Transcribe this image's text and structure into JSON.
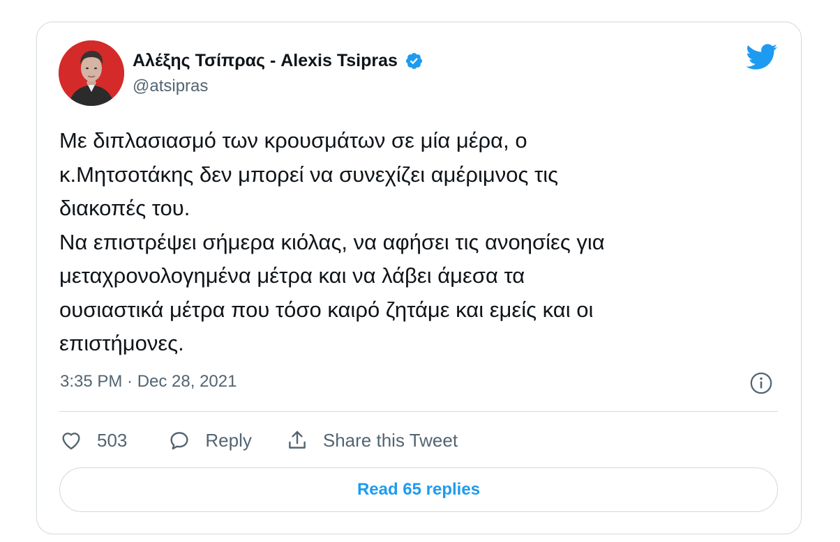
{
  "author": {
    "display_name": "Αλέξης Τσίπρας - Alexis Tsipras",
    "handle": "@atsipras"
  },
  "tweet": {
    "lines": [
      "Με διπλασιασμό των κρουσμάτων σε μία μέρα, ο",
      "κ.Μητσοτάκης δεν μπορεί να συνεχίζει αμέριμνος τις",
      "διακοπές του.",
      "Να επιστρέψει σήμερα κιόλας, να αφήσει τις ανοησίες για",
      "μεταχρονολογημένα μέτρα και να λάβει άμεσα τα",
      "ουσιαστικά μέτρα που τόσο καιρό ζητάμε και εμείς και οι",
      "επιστήμονες."
    ],
    "timestamp": "3:35 PM · Dec 28, 2021"
  },
  "actions": {
    "like_count": "503",
    "reply_label": "Reply",
    "share_label": "Share this Tweet"
  },
  "read_replies_label": "Read 65 replies",
  "icons": {
    "brand": "twitter-bird-icon",
    "verified": "verified-badge-icon",
    "info": "info-icon",
    "like": "heart-icon",
    "reply": "speech-bubble-icon",
    "share": "share-upload-icon"
  },
  "colors": {
    "accent": "#1d9bf0",
    "text_primary": "#0f1419",
    "text_secondary": "#536471",
    "border": "#cfd9de",
    "avatar_background": "#d52a2a"
  }
}
